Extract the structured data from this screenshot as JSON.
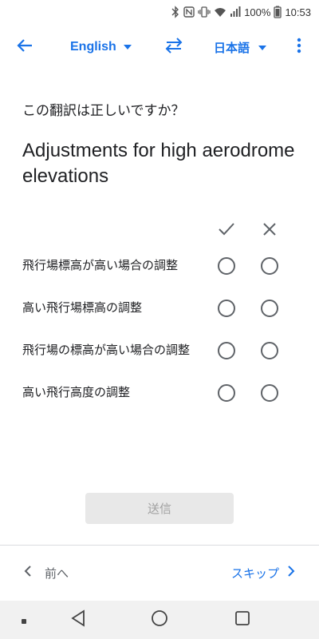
{
  "status_bar": {
    "battery_percent": "100%",
    "time": "10:53",
    "icons": [
      "bluetooth-icon",
      "nfc-icon",
      "vibrate-icon",
      "wifi-icon",
      "signal-icon",
      "battery-icon"
    ]
  },
  "toolbar": {
    "source_language": "English",
    "target_language": "日本語",
    "icons": [
      "back-arrow-icon",
      "dropdown-icon",
      "swap-icon",
      "more-vert-icon"
    ]
  },
  "review": {
    "question": "この翻訳は正しいですか？",
    "source_text": "Adjustments for high aerodrome elevations",
    "column_icons": [
      "check-icon",
      "close-icon"
    ],
    "options": [
      {
        "label": "飛行場標高が高い場合の調整"
      },
      {
        "label": "高い飛行場標高の調整"
      },
      {
        "label": "飛行場の標高が高い場合の調整"
      },
      {
        "label": "高い飛行高度の調整"
      }
    ],
    "submit_label": "送信"
  },
  "footer": {
    "prev_label": "前へ",
    "skip_label": "スキップ"
  },
  "navigation_bar": {
    "icons": [
      "recents-dot-icon",
      "back-triangle-icon",
      "home-circle-icon",
      "overview-square-icon"
    ]
  },
  "colors": {
    "accent": "#1a73e8",
    "text": "#202124",
    "radio_border": "#5f6368",
    "submit_disabled_bg": "#e8e8e8"
  }
}
